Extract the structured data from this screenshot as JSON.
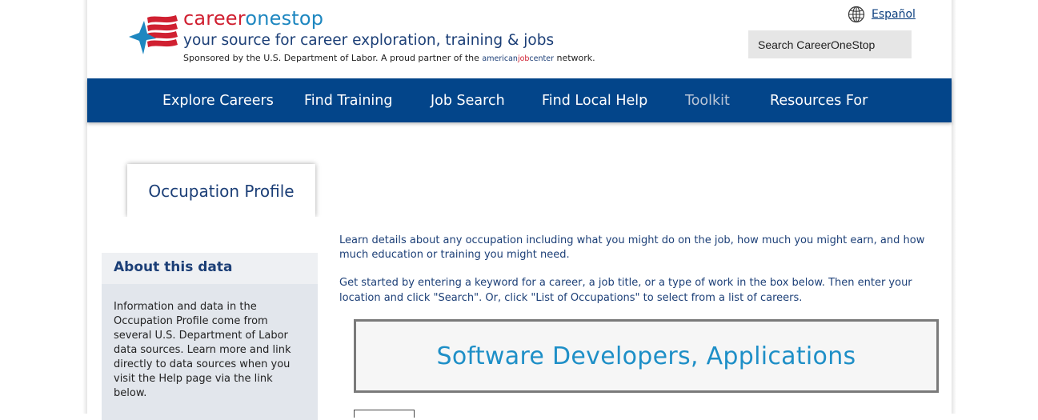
{
  "header": {
    "brand_part1": "career",
    "brand_part2": "onestop",
    "tagline": "your source for career exploration, training & jobs",
    "sponsor_text": "Sponsored by the U.S. Department of Labor. A proud partner of the",
    "partner_logo_part1": "american",
    "partner_logo_part2": "job",
    "partner_logo_part3": "center",
    "sponsor_suffix": "network.",
    "language_link": "Español",
    "search_placeholder": "Search CareerOneStop"
  },
  "nav": {
    "items": [
      {
        "label": "Explore Careers"
      },
      {
        "label": "Find Training"
      },
      {
        "label": "Job Search"
      },
      {
        "label": "Find Local Help"
      },
      {
        "label": "Toolkit"
      },
      {
        "label": "Resources For"
      }
    ]
  },
  "tab": {
    "label": "Occupation Profile"
  },
  "sidebar": {
    "heading": "About this data",
    "body": "Information and data in the Occupation Profile come from several U.S. Department of Labor data sources. Learn more and link directly to data sources when you visit the Help page via the link below."
  },
  "main": {
    "intro_1": "Learn details about any occupation including what you might do on the job, how much you might earn, and how much education or training you might need.",
    "intro_2": "Get started by entering a keyword for a career, a job title, or a type of work in the box below. Then enter your location and click \"Search\". Or, click \"List of Occupations\" to select from a list of careers.",
    "occupation_title": "Software Developers, Applications"
  },
  "colors": {
    "nav_bg": "#03458a",
    "brand_red": "#d02031",
    "brand_blue": "#1e87c0",
    "title_blue": "#1e8fc7"
  },
  "icons": [
    "careeronestop-logo-icon",
    "globe-icon"
  ]
}
